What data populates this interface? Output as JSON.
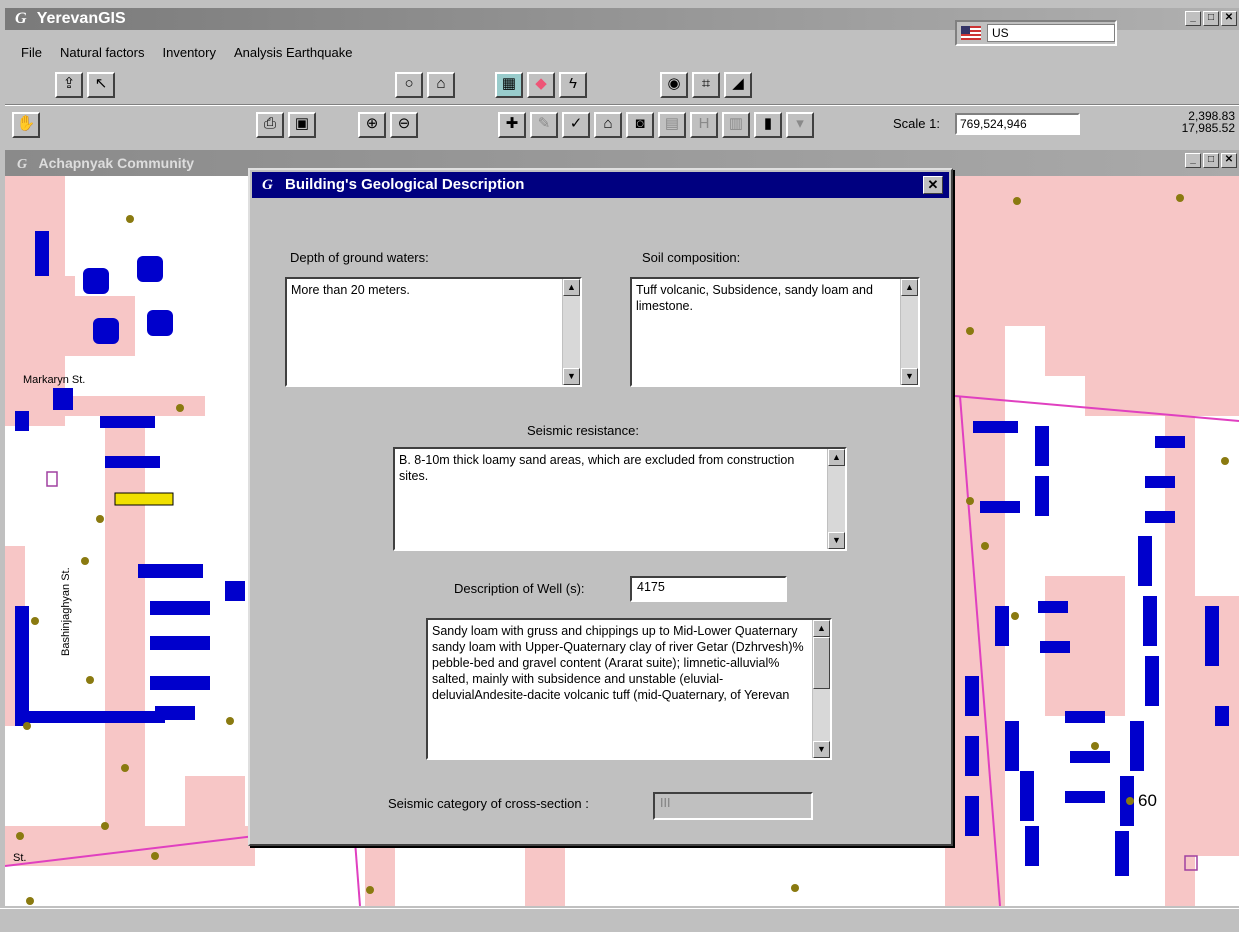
{
  "app": {
    "title": "YerevanGIS",
    "logo": "G",
    "language": "US",
    "menu": [
      "File",
      "Natural factors",
      "Inventory",
      "Analysis Earthquake"
    ]
  },
  "toolbar": {
    "scale_label": "Scale 1:",
    "scale_value": "769,524,946",
    "coord_x": "2,398.83",
    "coord_y": "17,985.52"
  },
  "map_window": {
    "title": "Achapnyak Community",
    "street_labels": {
      "markaryan": "Markaryn St.",
      "bashinjaghyan": "Bashinjaghyan St.",
      "st": "St.",
      "number": "60"
    },
    "colors": {
      "building": "#0000cc",
      "road": "#f7c6c6",
      "highlight": "#f0e000",
      "street_line": "#e040c0"
    }
  },
  "dialog": {
    "logo": "G",
    "title": "Building's Geological Description",
    "close": "✕",
    "depth_label": "Depth of ground waters:",
    "depth_value": "More than 20 meters.",
    "soil_label": "Soil composition:",
    "soil_value": "     Tuff volcanic,     Subsidence, sandy loam and limestone.",
    "seismic_label": "Seismic resistance:",
    "seismic_value": "     B. 8-10m thick loamy sand areas, which are excluded from construction sites.",
    "well_label": "Description of Well (s):",
    "well_value": "4175",
    "well_text": "Sandy loam with gruss and chippings up to Mid-Lower Quaternary sandy loam with Upper-Quaternary clay of river Getar (Dzhrvesh)% pebble-bed and gravel content (Ararat suite); limnetic-alluvial% salted, mainly with subsidence and unstable (eluvial-deluvialAndesite-dacite volcanic tuff (mid-Quaternary, of Yerevan",
    "category_label": "Seismic category of cross-section :",
    "category_value": "III"
  }
}
